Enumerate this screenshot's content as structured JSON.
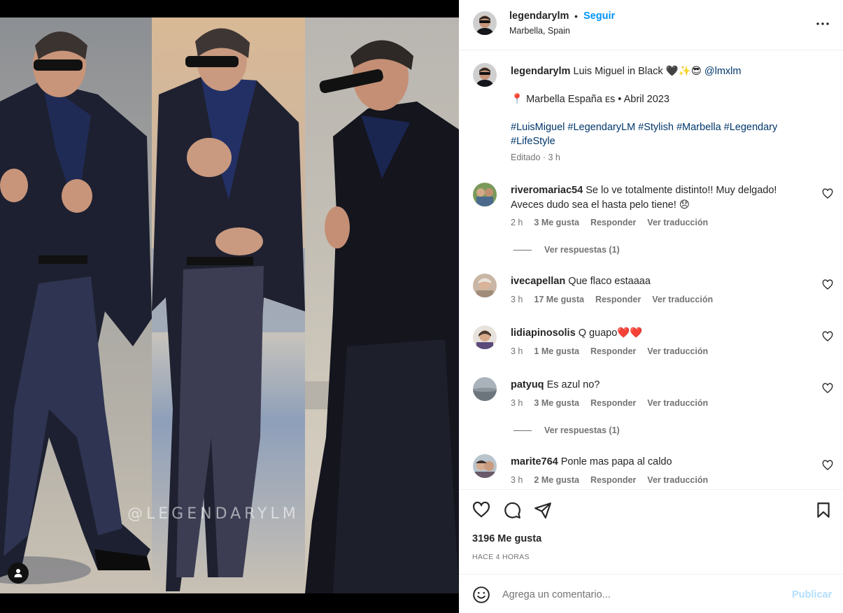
{
  "post": {
    "username": "legendarylm",
    "separator": "•",
    "follow_label": "Seguir",
    "location": "Marbella, Spain",
    "watermark": "@LEGENDARYLM"
  },
  "caption": {
    "username": "legendarylm",
    "text": "Luis Miguel in Black 🖤✨😎",
    "mention": "@lmxlm",
    "line2": "📍 Marbella España ᴇs • Abril 2023",
    "hashtags": "#LuisMiguel #LegendaryLM #Stylish #Marbella #Legendary #LifeStyle",
    "meta": "Editado · 3 h"
  },
  "comments": [
    {
      "username": "riveromariac54",
      "text": "Se lo ve totalmente distinto!! Muy delgado! Aveces dudo sea el hasta pelo tiene! 😞",
      "time": "2 h",
      "likes": "3 Me gusta",
      "reply": "Responder",
      "translate": "Ver traducción",
      "replies": "Ver respuestas (1)"
    },
    {
      "username": "ivecapellan",
      "text": "Que flaco estaaaa",
      "time": "3 h",
      "likes": "17 Me gusta",
      "reply": "Responder",
      "translate": "Ver traducción"
    },
    {
      "username": "lidiapinosolis",
      "text": "Q guapo❤️❤️",
      "time": "3 h",
      "likes": "1 Me gusta",
      "reply": "Responder",
      "translate": "Ver traducción"
    },
    {
      "username": "patyuq",
      "text": "Es azul no?",
      "time": "3 h",
      "likes": "3 Me gusta",
      "reply": "Responder",
      "translate": "Ver traducción",
      "replies": "Ver respuestas (1)"
    },
    {
      "username": "marite764",
      "text": "Ponle mas papa al caldo",
      "time": "3 h",
      "likes": "2 Me gusta",
      "reply": "Responder",
      "translate": "Ver traducción"
    }
  ],
  "stats": {
    "likes": "3196 Me gusta",
    "time": "HACE 4 HORAS"
  },
  "composer": {
    "placeholder": "Agrega un comentario...",
    "publish": "Publicar"
  },
  "colors": {
    "accent": "#0095f6",
    "link": "#00376b",
    "publish_disabled": "#b2dffc"
  }
}
